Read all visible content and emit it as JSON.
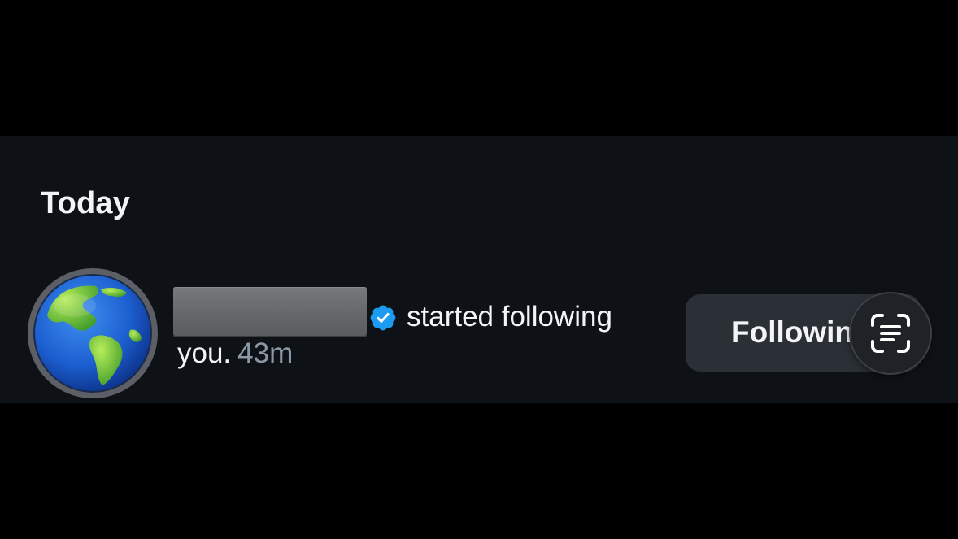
{
  "section": {
    "title": "Today"
  },
  "notification": {
    "avatar_icon": "globe-icon",
    "name_redacted": true,
    "verified_icon": "verified-badge-icon",
    "text_part1": "started following",
    "text_part2": "you.",
    "timestamp": "43m"
  },
  "follow_button": {
    "label": "Followin"
  },
  "overlay": {
    "icon": "live-text-scan-icon"
  },
  "colors": {
    "panel_bg": "#0e1216",
    "button_bg": "#2a3036",
    "verified_blue": "#1d9bf0",
    "muted_text": "#8b98a5"
  }
}
